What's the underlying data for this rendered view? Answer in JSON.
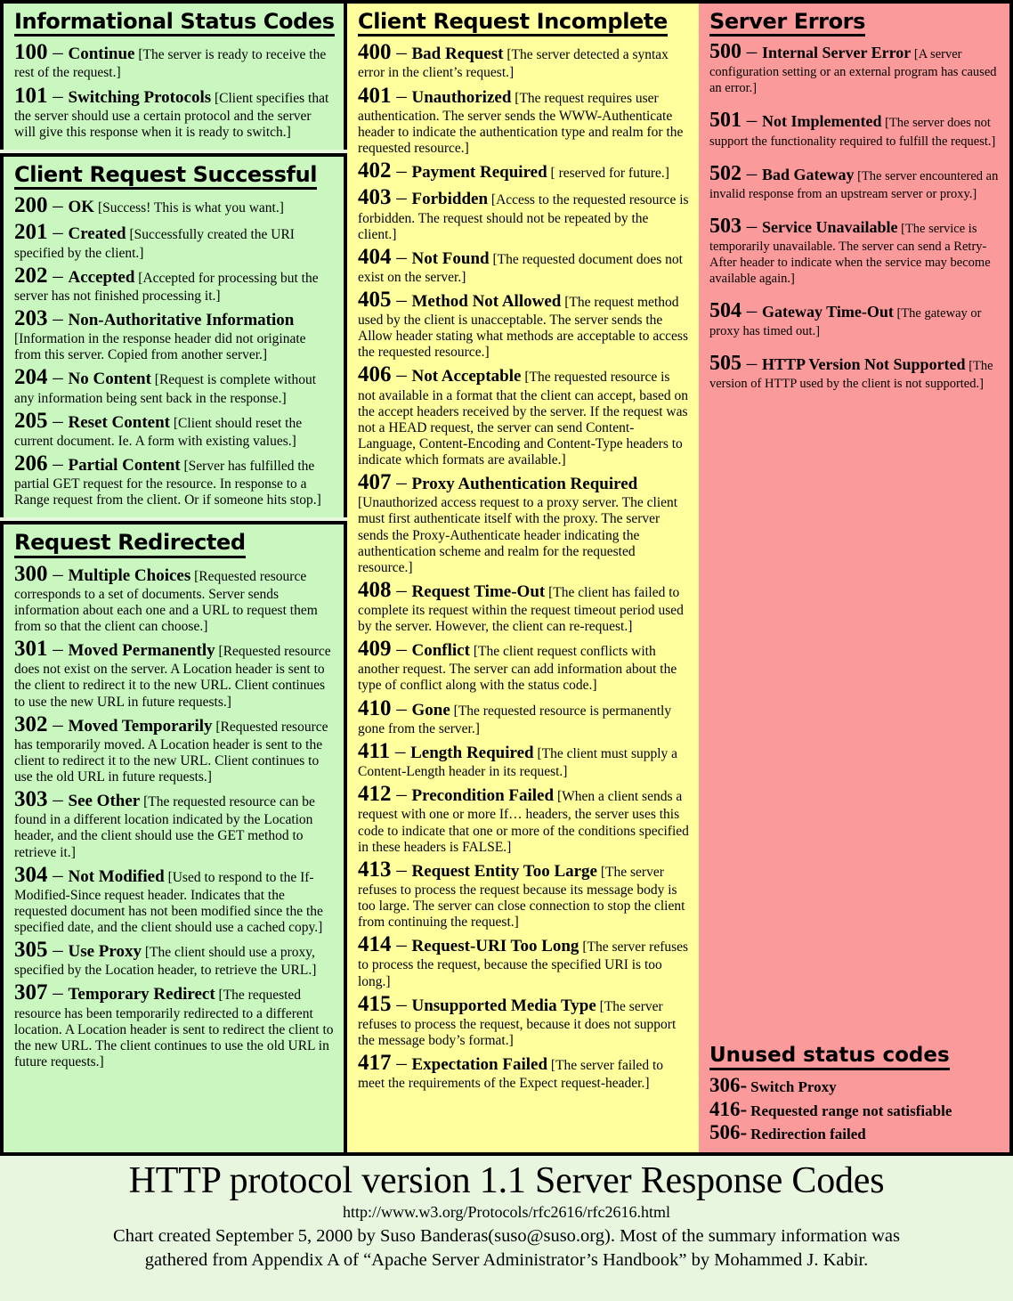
{
  "colors": {
    "informational_bg": "#c9f7bf",
    "success_bg": "#c9f7bf",
    "redirect_bg": "#c9f7bf",
    "client_error_bg": "#ffff9e",
    "server_error_bg": "#fb9a9a",
    "page_bg": "#e8f6e0",
    "border": "#000000"
  },
  "sections": {
    "informational": {
      "title": "Informational Status Codes",
      "entries": [
        {
          "code": "100",
          "dash": "–",
          "name": "Continue",
          "desc": "[The server is ready to receive the rest of the request.]"
        },
        {
          "code": "101",
          "dash": "–",
          "name": "Switching Protocols",
          "desc": "[Client specifies that the server should use a certain protocol and the server will give this response when it is ready to switch.]"
        }
      ]
    },
    "success": {
      "title": "Client Request Successful",
      "entries": [
        {
          "code": "200",
          "dash": "–",
          "name": "OK",
          "desc": "[Success! This is what you want.]"
        },
        {
          "code": "201",
          "dash": "–",
          "name": "Created",
          "desc": "[Successfully created the URI specified by the client.]"
        },
        {
          "code": "202",
          "dash": "–",
          "name": "Accepted",
          "desc": "[Accepted for processing but the server has not finished processing it.]"
        },
        {
          "code": "203",
          "dash": "–",
          "name": "Non-Authoritative Information",
          "desc": "[Information in the response header did not originate from this server. Copied from another server.]"
        },
        {
          "code": "204",
          "dash": "–",
          "name": "No Content",
          "desc": "[Request is complete without any information being sent back in the response.]"
        },
        {
          "code": "205",
          "dash": "–",
          "name": "Reset Content",
          "desc": "[Client should reset the current document.  Ie. A form with existing values.]"
        },
        {
          "code": "206",
          "dash": "–",
          "name": "Partial Content",
          "desc": "[Server has fulfilled the partial GET request for the resource. In response to a Range request from the client. Or if someone hits stop.]"
        }
      ]
    },
    "redirect": {
      "title": "Request Redirected",
      "entries": [
        {
          "code": "300",
          "dash": "–",
          "name": "Multiple Choices",
          "desc": "[Requested resource corresponds to a set of documents. Server sends information about each one and a URL to request them from so that the client can choose.]"
        },
        {
          "code": "301",
          "dash": "–",
          "name": "Moved Permanently",
          "desc": "[Requested resource does not exist on the server.  A Location header is sent to the client to redirect it to the new URL. Client continues to use the new URL in future requests.]"
        },
        {
          "code": "302",
          "dash": "–",
          "name": "Moved Temporarily",
          "desc": "[Requested resource has temporarily moved.  A Location header is sent to the client to redirect it to the new URL. Client continues to use the old URL in future requests.]"
        },
        {
          "code": "303",
          "dash": "–",
          "name": "See Other",
          "desc": "[The requested resource can be found in a different location indicated by the Location header, and the client should use the GET method to retrieve it.]"
        },
        {
          "code": "304",
          "dash": "–",
          "name": "Not Modified",
          "desc": "[Used to respond to the If-Modified-Since request header.  Indicates that the requested document has not been modified since the the specified date, and the client should use a cached copy.]"
        },
        {
          "code": "305",
          "dash": "–",
          "name": "Use Proxy",
          "desc": "[The client should use a proxy, specified by the Location header, to retrieve the URL.]"
        },
        {
          "code": "307",
          "dash": "–",
          "name": "Temporary Redirect",
          "desc": "[The requested resource has been temporarily redirected to a different location.  A Location header is sent to redirect the client to the new URL.  The client continues to use the old URL in future requests.]"
        }
      ]
    },
    "client_error": {
      "title": "Client Request Incomplete",
      "entries": [
        {
          "code": "400",
          "dash": "–",
          "name": "Bad Request",
          "desc": "[The server detected a syntax error in the client’s request.]"
        },
        {
          "code": "401",
          "dash": "–",
          "name": "Unauthorized",
          "desc": "[The request requires user authentication.  The server sends the WWW-Authenticate header to indicate the authentication type and realm for the requested resource.]"
        },
        {
          "code": "402",
          "dash": "–",
          "name": "Payment Required",
          "desc": "[ reserved for future.]"
        },
        {
          "code": "403",
          "dash": "–",
          "name": "Forbidden",
          "desc": "[Access to the requested resource is forbidden. The request should not be repeated by the client.]"
        },
        {
          "code": "404",
          "dash": "–",
          "name": "Not Found",
          "desc": "[The requested document does not exist on the server.]"
        },
        {
          "code": "405",
          "dash": "–",
          "name": "Method Not Allowed",
          "desc": "[The request method used by the client is unacceptable.  The server sends the Allow header stating what methods are acceptable to access the requested resource.]"
        },
        {
          "code": "406",
          "dash": "–",
          "name": "Not Acceptable",
          "desc": "[The requested resource is not available in a format that the client can accept, based on the accept headers received by the server. If the request was not a HEAD request, the server can send Content-Language, Content-Encoding and Content-Type headers to indicate which formats are available.]"
        },
        {
          "code": "407",
          "dash": "–",
          "name": "Proxy Authentication Required",
          "desc": "[Unauthorized access request to a proxy server. The client must first authenticate itself with the proxy.  The server sends the Proxy-Authenticate header indicating the authentication scheme and realm for the requested resource.]"
        },
        {
          "code": "408",
          "dash": "–",
          "name": "Request Time-Out",
          "desc": "[The client has failed to complete its request within the request timeout period used by the server. However, the client can re-request.]"
        },
        {
          "code": "409",
          "dash": "–",
          "name": "Conflict",
          "desc": "[The client request conflicts with another request.  The server can add information about the type of conflict along with the status code.]"
        },
        {
          "code": "410",
          "dash": "–",
          "name": "Gone",
          "desc": "[The requested resource is permanently gone from the server.]"
        },
        {
          "code": "411",
          "dash": "–",
          "name": "Length Required",
          "desc": "[The client must supply a Content-Length header in its request.]"
        },
        {
          "code": "412",
          "dash": "–",
          "name": "Precondition Failed",
          "desc": "[When a client sends a request with one or more If… headers, the server uses this code to indicate that one or more of the conditions specified in these headers is FALSE.]"
        },
        {
          "code": "413",
          "dash": "–",
          "name": "Request Entity Too Large",
          "desc": "[The server refuses to process the request because its message body is too large.  The server can close connection to stop the client from continuing the request.]"
        },
        {
          "code": "414",
          "dash": "–",
          "name": "Request-URI Too Long",
          "desc": "[The server refuses to process the request, because the specified URI is too long.]"
        },
        {
          "code": "415",
          "dash": "–",
          "name": "Unsupported Media Type",
          "desc": "[The server refuses to process the request, because it does not support the message body’s format.]"
        },
        {
          "code": "417",
          "dash": "–",
          "name": "Expectation Failed",
          "desc": "[The server failed to meet the requirements of the Expect request-header.]"
        }
      ]
    },
    "server_error": {
      "title": "Server Errors",
      "entries": [
        {
          "code": "500",
          "dash": "–",
          "name": "Internal Server Error",
          "desc": "[A server configuration setting or an external program has caused an error.]"
        },
        {
          "code": "501",
          "dash": "–",
          "name": "Not Implemented",
          "desc": "[The server does not support the functionality required to fulfill the request.]"
        },
        {
          "code": "502",
          "dash": "–",
          "name": "Bad Gateway",
          "desc": "[The server encountered an invalid response from an upstream server or proxy.]"
        },
        {
          "code": "503",
          "dash": "–",
          "name": "Service Unavailable",
          "desc": "[The service is temporarily unavailable. The server can send a Retry-After header to indicate when the service may become available again.]"
        },
        {
          "code": "504",
          "dash": "–",
          "name": "Gateway Time-Out",
          "desc": "[The gateway or proxy has timed out.]"
        },
        {
          "code": "505",
          "dash": "–",
          "name": "HTTP Version Not Supported",
          "desc": "[The version of HTTP used by the client is not supported.]"
        }
      ]
    },
    "unused": {
      "title": "Unused status codes",
      "entries": [
        {
          "code": "306-",
          "name": "Switch Proxy"
        },
        {
          "code": "416-",
          "name": "Requested range not satisfiable"
        },
        {
          "code": "506-",
          "name": "Redirection failed"
        }
      ]
    }
  },
  "footer": {
    "title": "HTTP protocol version 1.1 Server Response Codes",
    "url": "http://www.w3.org/Protocols/rfc2616/rfc2616.html",
    "credit_line1": "Chart created September 5, 2000 by Suso Banderas(suso@suso.org). Most of the summary information was",
    "credit_line2": "gathered from Appendix A of “Apache Server Administrator’s Handbook” by Mohammed J. Kabir."
  }
}
